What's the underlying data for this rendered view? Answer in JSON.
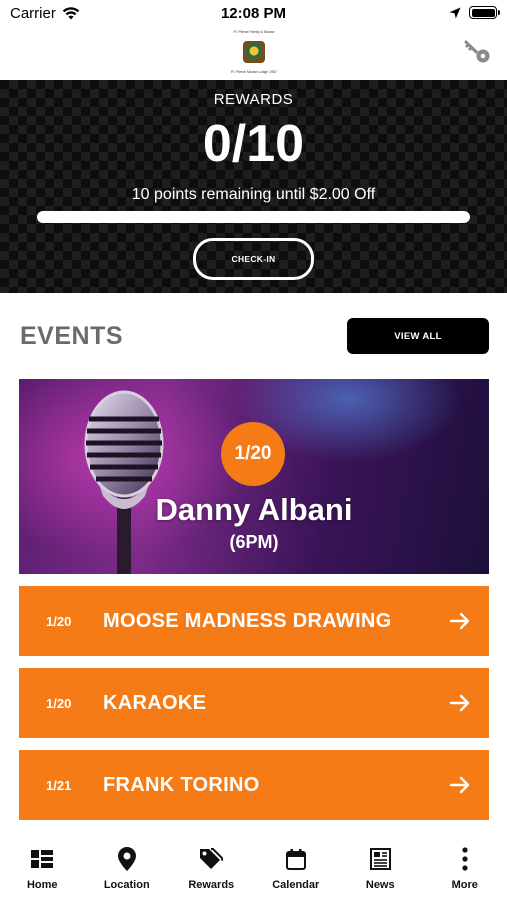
{
  "status_bar": {
    "carrier": "Carrier",
    "time": "12:08 PM"
  },
  "header": {
    "logo_top_text": "Ft. Pierce Family & Moose",
    "logo_bottom_text": "Ft. Pierce Moose Lodge 1957",
    "key_icon": "key-icon"
  },
  "rewards": {
    "title": "REWARDS",
    "score": "0/10",
    "remaining_text": "10 points remaining until $2.00 Off",
    "progress": 0,
    "checkin_label": "CHECK-IN"
  },
  "events": {
    "title": "EVENTS",
    "view_all_label": "VIEW ALL",
    "featured": {
      "date": "1/20",
      "name": "Danny Albani",
      "time": "(6PM)"
    },
    "list": [
      {
        "date": "1/20",
        "name": "MOOSE MADNESS DRAWING"
      },
      {
        "date": "1/20",
        "name": "KARAOKE"
      },
      {
        "date": "1/21",
        "name": "FRANK TORINO"
      }
    ]
  },
  "tabs": [
    {
      "label": "Home",
      "icon": "home-grid-icon"
    },
    {
      "label": "Location",
      "icon": "location-pin-icon"
    },
    {
      "label": "Rewards",
      "icon": "tags-icon"
    },
    {
      "label": "Calendar",
      "icon": "calendar-icon"
    },
    {
      "label": "News",
      "icon": "newspaper-icon"
    },
    {
      "label": "More",
      "icon": "more-vertical-icon"
    }
  ],
  "colors": {
    "accent": "#f47b16",
    "dark": "#000000",
    "muted_heading": "#6b6b6b"
  }
}
